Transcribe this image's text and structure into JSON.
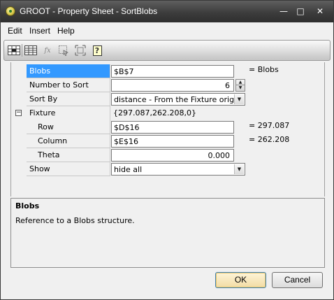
{
  "window": {
    "title": "GROOT - Property Sheet - SortBlobs",
    "minimize_glyph": "—",
    "maximize_glyph": "□",
    "close_glyph": "✕"
  },
  "menu": {
    "items": [
      "Edit",
      "Insert",
      "Help"
    ]
  },
  "toolbar": {
    "icons": [
      "cell-reference-icon",
      "table-grid-icon",
      "function-icon",
      "select-point-icon",
      "fit-view-icon",
      "help-icon"
    ],
    "function_glyph": "fx",
    "help_glyph": "?"
  },
  "properties": {
    "blobs": {
      "label": "Blobs",
      "value": "$B$7",
      "result": "= Blobs"
    },
    "number_to_sort": {
      "label": "Number to Sort",
      "value": "6"
    },
    "sort_by": {
      "label": "Sort By",
      "value": "distance - From the Fixture origin"
    },
    "fixture": {
      "label": "Fixture",
      "value": "{297.087,262.208,0}",
      "toggle": "−"
    },
    "row": {
      "label": "Row",
      "value": "$D$16",
      "result": "= 297.087"
    },
    "column": {
      "label": "Column",
      "value": "$E$16",
      "result": "= 262.208"
    },
    "theta": {
      "label": "Theta",
      "value": "0.000"
    },
    "show": {
      "label": "Show",
      "value": "hide all"
    }
  },
  "description": {
    "title": "Blobs",
    "text": "Reference to a Blobs structure."
  },
  "buttons": {
    "ok": "OK",
    "cancel": "Cancel"
  },
  "colors": {
    "selection": "#3399ff",
    "title_bar": "#3d3d3d"
  }
}
